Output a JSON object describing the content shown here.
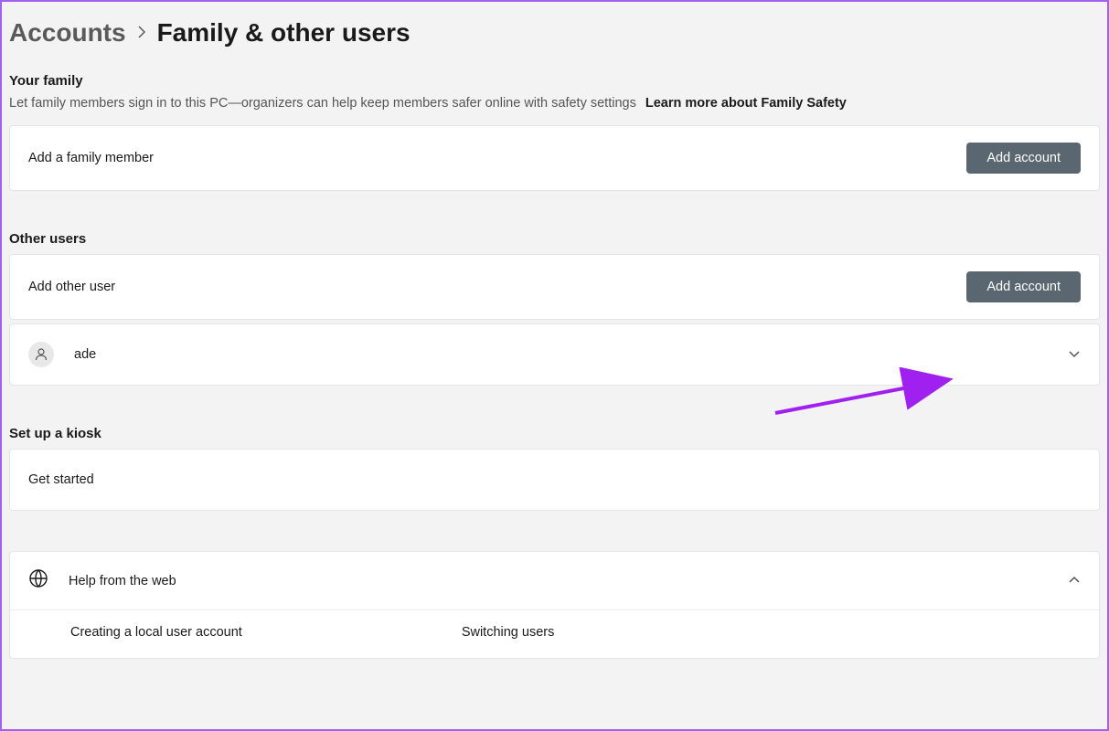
{
  "breadcrumb": {
    "parent": "Accounts",
    "current": "Family & other users"
  },
  "family": {
    "title": "Your family",
    "desc": "Let family members sign in to this PC—organizers can help keep members safer online with safety settings",
    "learn_more": "Learn more about Family Safety",
    "add_label": "Add a family member",
    "add_button": "Add account"
  },
  "other_users": {
    "title": "Other users",
    "add_label": "Add other user",
    "add_button": "Add account",
    "user_name": "ade"
  },
  "kiosk": {
    "title": "Set up a kiosk",
    "get_started": "Get started"
  },
  "help": {
    "title": "Help from the web",
    "link1": "Creating a local user account",
    "link2": "Switching users"
  }
}
